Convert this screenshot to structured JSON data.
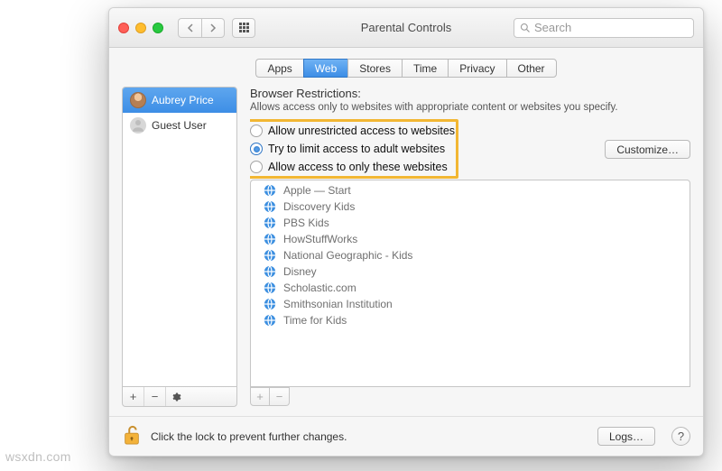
{
  "window": {
    "title": "Parental Controls"
  },
  "search": {
    "placeholder": "Search"
  },
  "tabs": [
    {
      "label": "Apps",
      "selected": false
    },
    {
      "label": "Web",
      "selected": true
    },
    {
      "label": "Stores",
      "selected": false
    },
    {
      "label": "Time",
      "selected": false
    },
    {
      "label": "Privacy",
      "selected": false
    },
    {
      "label": "Other",
      "selected": false
    }
  ],
  "sidebar": {
    "users": [
      {
        "name": "Aubrey Price",
        "selected": true
      },
      {
        "name": "Guest User",
        "selected": false
      }
    ]
  },
  "main": {
    "section_title": "Browser Restrictions:",
    "section_desc": "Allows access only to websites with appropriate content or websites you specify.",
    "radios": [
      {
        "label": "Allow unrestricted access to websites",
        "checked": false
      },
      {
        "label": "Try to limit access to adult websites",
        "checked": true
      },
      {
        "label": "Allow access to only these websites",
        "checked": false
      }
    ],
    "customize_label": "Customize…",
    "sites": [
      "Apple — Start",
      "Discovery Kids",
      "PBS Kids",
      "HowStuffWorks",
      "National Geographic - Kids",
      "Disney",
      "Scholastic.com",
      "Smithsonian Institution",
      "Time for Kids"
    ]
  },
  "footer": {
    "lock_text": "Click the lock to prevent further changes.",
    "logs_label": "Logs…"
  },
  "watermark": "wsxdn.com"
}
